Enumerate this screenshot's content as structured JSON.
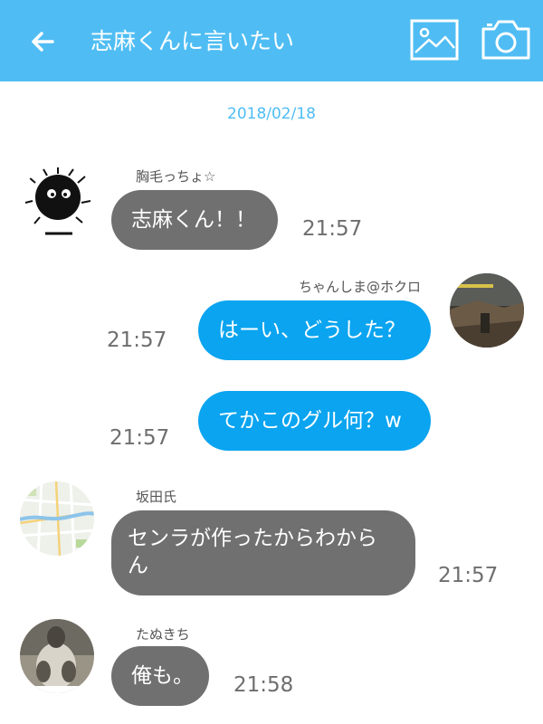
{
  "header": {
    "title": "志麻くんに言いたい",
    "background": "#4fbdf3",
    "icons": [
      "back-arrow-icon",
      "image-icon",
      "camera-icon"
    ]
  },
  "date_separator": "2018/02/18",
  "colors": {
    "incoming_bubble": "#707070",
    "outgoing_bubble": "#0aa4f0",
    "accent": "#4fbdf3"
  },
  "messages": [
    {
      "sender": "胸毛っちょ☆",
      "text": "志麻くん！！",
      "time": "21:57",
      "direction": "incoming"
    },
    {
      "sender": "ちゃんしま@ホクロ",
      "text": "はーい、どうした？",
      "time": "21:57",
      "direction": "outgoing"
    },
    {
      "sender": "",
      "text": "てかこのグル何？w",
      "time": "21:57",
      "direction": "outgoing"
    },
    {
      "sender": "坂田氏",
      "text_line1": "センラが作ったからわから",
      "text_line2": "ん",
      "time": "21:57",
      "direction": "incoming"
    },
    {
      "sender": "たぬきち",
      "text": "俺も。",
      "time": "21:58",
      "direction": "incoming"
    }
  ]
}
